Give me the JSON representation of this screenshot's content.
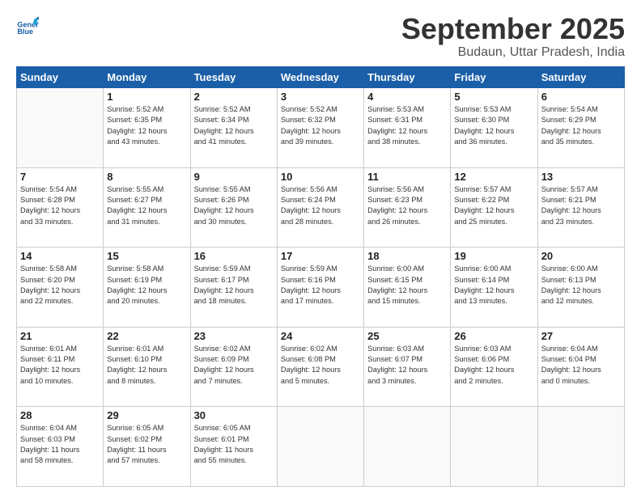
{
  "header": {
    "logo_line1": "General",
    "logo_line2": "Blue",
    "month": "September 2025",
    "location": "Budaun, Uttar Pradesh, India"
  },
  "weekdays": [
    "Sunday",
    "Monday",
    "Tuesday",
    "Wednesday",
    "Thursday",
    "Friday",
    "Saturday"
  ],
  "weeks": [
    [
      {
        "day": "",
        "info": ""
      },
      {
        "day": "1",
        "info": "Sunrise: 5:52 AM\nSunset: 6:35 PM\nDaylight: 12 hours\nand 43 minutes."
      },
      {
        "day": "2",
        "info": "Sunrise: 5:52 AM\nSunset: 6:34 PM\nDaylight: 12 hours\nand 41 minutes."
      },
      {
        "day": "3",
        "info": "Sunrise: 5:52 AM\nSunset: 6:32 PM\nDaylight: 12 hours\nand 39 minutes."
      },
      {
        "day": "4",
        "info": "Sunrise: 5:53 AM\nSunset: 6:31 PM\nDaylight: 12 hours\nand 38 minutes."
      },
      {
        "day": "5",
        "info": "Sunrise: 5:53 AM\nSunset: 6:30 PM\nDaylight: 12 hours\nand 36 minutes."
      },
      {
        "day": "6",
        "info": "Sunrise: 5:54 AM\nSunset: 6:29 PM\nDaylight: 12 hours\nand 35 minutes."
      }
    ],
    [
      {
        "day": "7",
        "info": "Sunrise: 5:54 AM\nSunset: 6:28 PM\nDaylight: 12 hours\nand 33 minutes."
      },
      {
        "day": "8",
        "info": "Sunrise: 5:55 AM\nSunset: 6:27 PM\nDaylight: 12 hours\nand 31 minutes."
      },
      {
        "day": "9",
        "info": "Sunrise: 5:55 AM\nSunset: 6:26 PM\nDaylight: 12 hours\nand 30 minutes."
      },
      {
        "day": "10",
        "info": "Sunrise: 5:56 AM\nSunset: 6:24 PM\nDaylight: 12 hours\nand 28 minutes."
      },
      {
        "day": "11",
        "info": "Sunrise: 5:56 AM\nSunset: 6:23 PM\nDaylight: 12 hours\nand 26 minutes."
      },
      {
        "day": "12",
        "info": "Sunrise: 5:57 AM\nSunset: 6:22 PM\nDaylight: 12 hours\nand 25 minutes."
      },
      {
        "day": "13",
        "info": "Sunrise: 5:57 AM\nSunset: 6:21 PM\nDaylight: 12 hours\nand 23 minutes."
      }
    ],
    [
      {
        "day": "14",
        "info": "Sunrise: 5:58 AM\nSunset: 6:20 PM\nDaylight: 12 hours\nand 22 minutes."
      },
      {
        "day": "15",
        "info": "Sunrise: 5:58 AM\nSunset: 6:19 PM\nDaylight: 12 hours\nand 20 minutes."
      },
      {
        "day": "16",
        "info": "Sunrise: 5:59 AM\nSunset: 6:17 PM\nDaylight: 12 hours\nand 18 minutes."
      },
      {
        "day": "17",
        "info": "Sunrise: 5:59 AM\nSunset: 6:16 PM\nDaylight: 12 hours\nand 17 minutes."
      },
      {
        "day": "18",
        "info": "Sunrise: 6:00 AM\nSunset: 6:15 PM\nDaylight: 12 hours\nand 15 minutes."
      },
      {
        "day": "19",
        "info": "Sunrise: 6:00 AM\nSunset: 6:14 PM\nDaylight: 12 hours\nand 13 minutes."
      },
      {
        "day": "20",
        "info": "Sunrise: 6:00 AM\nSunset: 6:13 PM\nDaylight: 12 hours\nand 12 minutes."
      }
    ],
    [
      {
        "day": "21",
        "info": "Sunrise: 6:01 AM\nSunset: 6:11 PM\nDaylight: 12 hours\nand 10 minutes."
      },
      {
        "day": "22",
        "info": "Sunrise: 6:01 AM\nSunset: 6:10 PM\nDaylight: 12 hours\nand 8 minutes."
      },
      {
        "day": "23",
        "info": "Sunrise: 6:02 AM\nSunset: 6:09 PM\nDaylight: 12 hours\nand 7 minutes."
      },
      {
        "day": "24",
        "info": "Sunrise: 6:02 AM\nSunset: 6:08 PM\nDaylight: 12 hours\nand 5 minutes."
      },
      {
        "day": "25",
        "info": "Sunrise: 6:03 AM\nSunset: 6:07 PM\nDaylight: 12 hours\nand 3 minutes."
      },
      {
        "day": "26",
        "info": "Sunrise: 6:03 AM\nSunset: 6:06 PM\nDaylight: 12 hours\nand 2 minutes."
      },
      {
        "day": "27",
        "info": "Sunrise: 6:04 AM\nSunset: 6:04 PM\nDaylight: 12 hours\nand 0 minutes."
      }
    ],
    [
      {
        "day": "28",
        "info": "Sunrise: 6:04 AM\nSunset: 6:03 PM\nDaylight: 11 hours\nand 58 minutes."
      },
      {
        "day": "29",
        "info": "Sunrise: 6:05 AM\nSunset: 6:02 PM\nDaylight: 11 hours\nand 57 minutes."
      },
      {
        "day": "30",
        "info": "Sunrise: 6:05 AM\nSunset: 6:01 PM\nDaylight: 11 hours\nand 55 minutes."
      },
      {
        "day": "",
        "info": ""
      },
      {
        "day": "",
        "info": ""
      },
      {
        "day": "",
        "info": ""
      },
      {
        "day": "",
        "info": ""
      }
    ]
  ]
}
